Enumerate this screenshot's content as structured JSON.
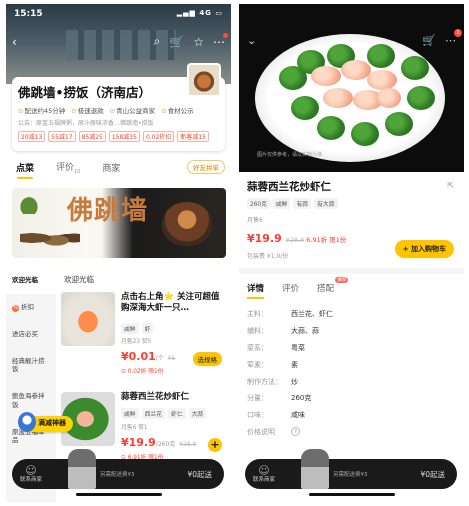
{
  "left": {
    "status": {
      "time": "15:15",
      "signal": "4G"
    },
    "shop": {
      "name": "佛跳墙•捞饭（济南店）",
      "info": [
        "配送约45分钟",
        "极速退款",
        "青山公益商家",
        "食材公示"
      ],
      "notice": "公告：原盅五福牌粥，原汁原味浓香…佛跳墙•捞饭",
      "coupons": [
        "20减13",
        "55减17",
        "85减25",
        "158减35",
        "0.02折扣",
        "新客减15"
      ]
    },
    "tabs": [
      {
        "label": "点菜",
        "count": ""
      },
      {
        "label": "评价",
        "count": "10"
      },
      {
        "label": "商家",
        "count": ""
      }
    ],
    "pill": "好友拼单",
    "banner_logo": "佛跳墙",
    "section_head": "欢迎光临",
    "sidebar": [
      {
        "label": "欢迎光临",
        "dot": ""
      },
      {
        "label": "折扣",
        "dot": "%"
      },
      {
        "label": "进店必买",
        "dot": ""
      },
      {
        "label": "经典靓汁捞饭",
        "dot": ""
      },
      {
        "label": "鲍鱼海参拌饭",
        "dot": ""
      },
      {
        "label": "原盅五福单品",
        "dot": ""
      }
    ],
    "dishes": [
      {
        "title": "点击右上角⭐ 关注可超值购深海大虾一只…",
        "tags": [
          "咸鲜",
          "虾"
        ],
        "sales": "月售23  赞5",
        "price": "¥0.01",
        "unit": "/个",
        "orig": "¥5",
        "sub": "0.02折 限1份",
        "btn": "选规格"
      },
      {
        "title": "蒜蓉西兰花炒虾仁",
        "tags": [
          "咸鲜",
          "西兰花",
          "虾仁",
          "大蒜"
        ],
        "sales": "月售6  赞1",
        "price": "¥19.9",
        "unit": "/260克",
        "orig": "¥28.8",
        "sub": "6.91折 限1份",
        "btn": "+"
      }
    ],
    "float_btn": "满减神器",
    "cart": {
      "label": "联系商家",
      "fee": "另需配送费¥3",
      "go": "¥0起送"
    }
  },
  "right": {
    "watermark": "图片仅供参考，请以实物为准",
    "title": "蒜蓉西兰花炒虾仁",
    "tags": [
      "260克",
      "咸鲜",
      "有蒜",
      "有大蒜"
    ],
    "sales": "月售6",
    "price": "¥19.9",
    "orig": "¥28.8",
    "discount": "6.91折 限1份",
    "pack": "包装费 ¥1.0/份",
    "add_btn": "+ 加入购物车",
    "tabs": [
      {
        "label": "详情"
      },
      {
        "label": "评价"
      },
      {
        "label": "搭配",
        "hot": "推荐"
      }
    ],
    "spec": [
      {
        "k": "主料：",
        "v": "西兰花、虾仁"
      },
      {
        "k": "辅料：",
        "v": "大蒜、蒜"
      },
      {
        "k": "菜系：",
        "v": "粤菜"
      },
      {
        "k": "荤素：",
        "v": "素"
      },
      {
        "k": "制作方法：",
        "v": "炒"
      },
      {
        "k": "分量：",
        "v": "260克"
      },
      {
        "k": "口味：",
        "v": "咸味"
      },
      {
        "k": "价格说明",
        "v": "?"
      }
    ],
    "cart": {
      "label": "联系商家",
      "fee": "另需配送费¥3",
      "go": "¥0起送"
    }
  }
}
